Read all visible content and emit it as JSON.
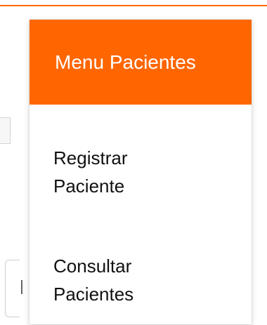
{
  "menu": {
    "title": "Menu Pacientes",
    "items": [
      {
        "line1": "Registrar",
        "line2": "Paciente"
      },
      {
        "line1": "Consultar",
        "line2": "Pacientes"
      }
    ]
  },
  "colors": {
    "accent": "#ff6600",
    "text": "#111111",
    "header_text": "#ffffff"
  }
}
